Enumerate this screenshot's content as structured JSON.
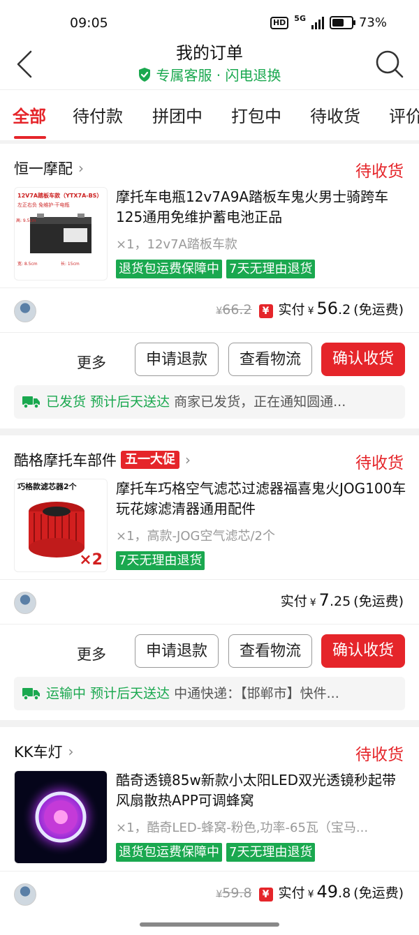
{
  "status_bar": {
    "time": "09:05",
    "network": "5G",
    "hd": "HD",
    "battery": "73%",
    "battery_level": 0.73
  },
  "header": {
    "title": "我的订单",
    "subtitle": "专属客服 · 闪电退换"
  },
  "tabs": [
    "全部",
    "待付款",
    "拼团中",
    "打包中",
    "待收货",
    "评价"
  ],
  "active_tab": "全部",
  "colors": {
    "accent": "#e5252a",
    "green": "#1aa84f"
  },
  "orders": [
    {
      "shop": "恒一摩配",
      "status": "待收货",
      "product_name": "摩托车电瓶12v7A9A踏板车鬼火男士骑跨车125通用免维护蓄电池正品",
      "spec": "×1，12v7A踏板车款",
      "badges": [
        "退货包运费保障中",
        "7天无理由退货"
      ],
      "thumb_title": "12V7A踏板车款（YTX7A-BS）",
      "thumb_note": "左正右负   免维护·干电瓶",
      "thumb_dims": [
        "高: 9.5cm",
        "宽: 8.5cm",
        "长: 15cm"
      ],
      "old_price": "66.2",
      "paid_label": "实付",
      "currency": "¥",
      "price_int": "56",
      "price_dec": ".2",
      "shipping": "(免运费)",
      "more": "更多",
      "btn_refund": "申请退款",
      "btn_logistics": "查看物流",
      "btn_confirm": "确认收货",
      "logistics_status": "已发货",
      "logistics_eta": "预计后天送达",
      "logistics_detail": "商家已发货，正在通知圆通..."
    },
    {
      "shop": "酷格摩托车部件",
      "promo": "五一大促",
      "status": "待收货",
      "product_name": "摩托车巧格空气滤芯过滤器福喜鬼火JOG100车玩花嫁滤清器通用配件",
      "spec": "×1，高款-JOG空气滤芯/2个",
      "badges": [
        "7天无理由退货"
      ],
      "thumb_title": "巧格款滤芯器2个",
      "thumb_qty": "×2",
      "paid_label": "实付",
      "currency": "¥",
      "price_int": "7",
      "price_dec": ".25",
      "shipping": "(免运费)",
      "more": "更多",
      "btn_refund": "申请退款",
      "btn_logistics": "查看物流",
      "btn_confirm": "确认收货",
      "logistics_status": "运输中",
      "logistics_eta": "预计后天送达",
      "logistics_detail": "中通快递：【邯郸市】快件..."
    },
    {
      "shop": "KK车灯",
      "status": "待收货",
      "product_name": "酷奇透镜85w新款小太阳LED双光透镜秒起带风扇散热APP可调蜂窝",
      "spec": "×1，酷奇LED-蜂窝-粉色,功率-65瓦（宝马...",
      "badges": [
        "退货包运费保障中",
        "7天无理由退货"
      ],
      "old_price": "59.8",
      "paid_label": "实付",
      "currency": "¥",
      "price_int": "49",
      "price_dec": ".8",
      "shipping": "(免运费)"
    }
  ]
}
